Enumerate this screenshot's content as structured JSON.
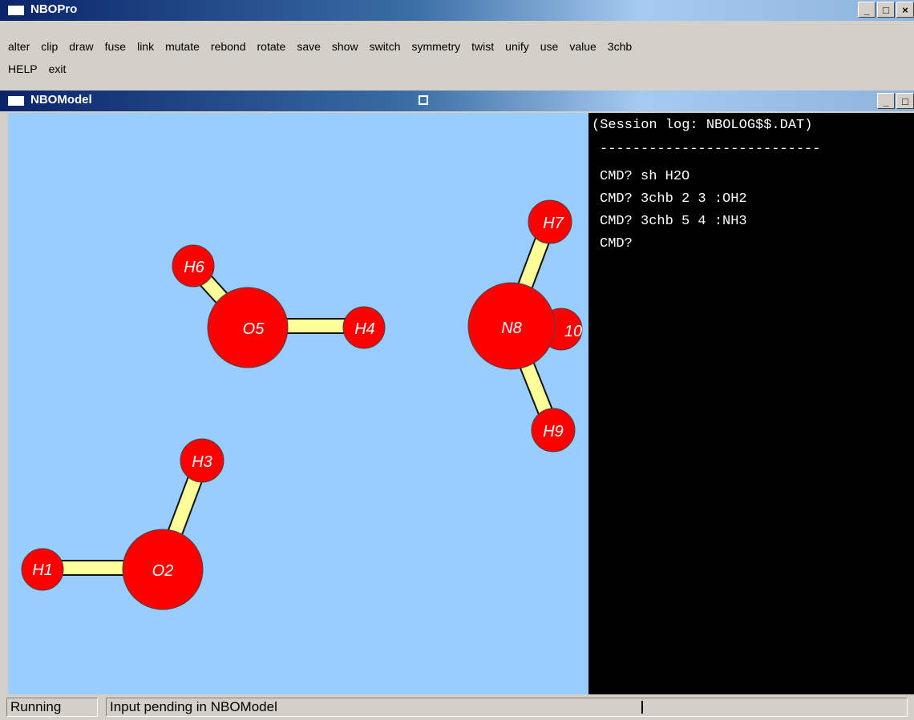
{
  "app": {
    "title": "NBOPro",
    "window_buttons": [
      "_",
      "□",
      "×"
    ]
  },
  "menu": {
    "row1": [
      "alter",
      "clip",
      "draw",
      "fuse",
      "link",
      "mutate",
      "rebond",
      "rotate",
      "save",
      "show",
      "switch",
      "symmetry",
      "twist",
      "unify",
      "use",
      "value",
      "3chb"
    ],
    "row2": [
      "HELP",
      "exit"
    ]
  },
  "child_window": {
    "title": "NBOModel",
    "window_buttons": [
      "_",
      "□"
    ]
  },
  "molecule": {
    "atom_color": "#ff0000",
    "bond_color": "#ffff99",
    "background": "#99ccff",
    "atoms": {
      "H1": "H1",
      "O2": "O2",
      "H3": "H3",
      "H4": "H4",
      "O5": "O5",
      "H6": "H6",
      "H7": "H7",
      "N8": "N8",
      "H9": "H9",
      "H10": "10"
    }
  },
  "console": {
    "header": "(Session log: NBOLOG$$.DAT)",
    "separator": "---------------------------",
    "lines": [
      "CMD? sh H2O",
      "CMD? 3chb 2 3 :OH2",
      "CMD? 3chb 5 4 :NH3",
      "CMD?"
    ]
  },
  "status": {
    "state": "Running",
    "message": "Input pending in NBOModel"
  }
}
